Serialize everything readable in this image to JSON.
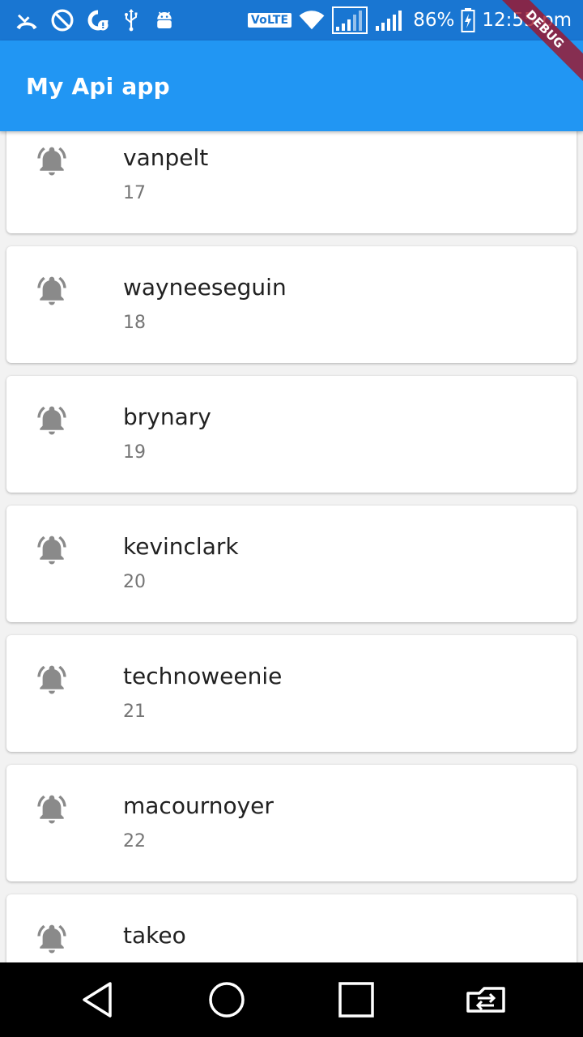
{
  "status_bar": {
    "volte": "VoLTE",
    "battery": "86%",
    "time": "12:55 pm",
    "icons": [
      "missed-call-icon",
      "do-not-disturb-icon",
      "data-saver-icon",
      "usb-icon",
      "android-debug-icon",
      "wifi-icon",
      "signal-sim1-icon",
      "signal-sim2-icon",
      "battery-charging-icon"
    ]
  },
  "app_bar": {
    "title": "My Api app"
  },
  "debug_banner": {
    "label": "DEBUG"
  },
  "colors": {
    "status_bar": "#1976d2",
    "app_bar": "#2196f3",
    "icon": "#8a8a8a"
  },
  "list": {
    "items": [
      {
        "name": "vanpelt",
        "id": "17",
        "icon": "notification-active-icon"
      },
      {
        "name": "wayneeseguin",
        "id": "18",
        "icon": "notification-active-icon"
      },
      {
        "name": "brynary",
        "id": "19",
        "icon": "notification-active-icon"
      },
      {
        "name": "kevinclark",
        "id": "20",
        "icon": "notification-active-icon"
      },
      {
        "name": "technoweenie",
        "id": "21",
        "icon": "notification-active-icon"
      },
      {
        "name": "macournoyer",
        "id": "22",
        "icon": "notification-active-icon"
      },
      {
        "name": "takeo",
        "id": "",
        "icon": "notification-active-icon"
      }
    ]
  },
  "nav_bar": {
    "buttons": [
      "back-icon",
      "home-icon",
      "recents-icon",
      "switch-sim-icon"
    ]
  }
}
